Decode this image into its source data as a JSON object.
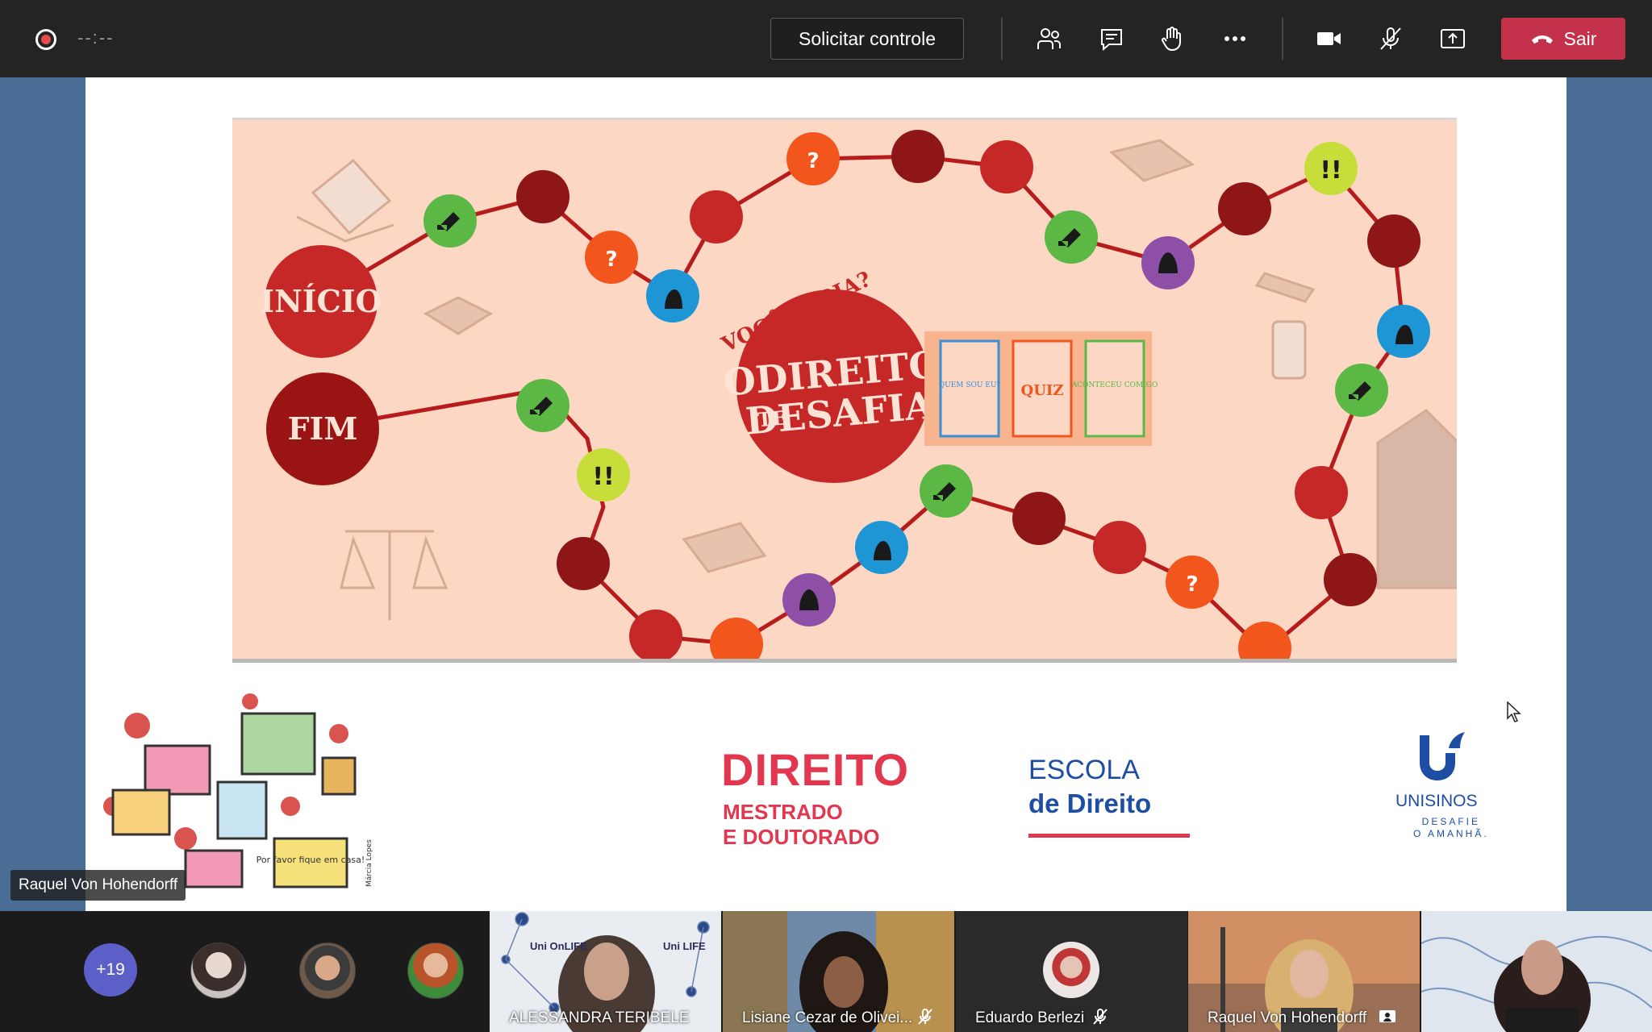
{
  "toolbar": {
    "timer": "--:--",
    "request_control_label": "Solicitar controle",
    "leave_label": "Sair",
    "icons": [
      "record-icon",
      "participants-icon",
      "chat-icon",
      "raise-hand-icon",
      "more-icon",
      "camera-icon",
      "mic-muted-icon",
      "share-icon",
      "phone-icon"
    ],
    "leave_color": "#c4314b"
  },
  "slide": {
    "board": {
      "start_label": "INÍCIO",
      "end_label": "FIM",
      "tagline": "VOCÊ SABIA?",
      "title_line1": "ODIREITO",
      "title_line2_small": "TE",
      "title_line2": "DESAFIA!",
      "cards": [
        "QUEM SOU EU?",
        "QUIZ",
        "ACONTECEU COMIGO"
      ],
      "background_color": "#fbd7c4",
      "path_color": "#b71c1c"
    },
    "illustration_signature": "Márcia Lopes",
    "illustration_note": "Por favor fique em casa!",
    "program_title": "DIREITO",
    "program_sub1": "MESTRADO",
    "program_sub2": "E DOUTORADO",
    "school_line1": "ESCOLA",
    "school_line2": "de Direito",
    "university_name": "UNISINOS",
    "university_tagline_1": "DESAFIE",
    "university_tagline_2": "O AMANHÃ.",
    "brand_red": "#e1374f",
    "brand_blue": "#1e4ea4"
  },
  "presenter_label": "Raquel Von Hohendorff",
  "participants": {
    "more_count": "+19",
    "tiles": [
      {
        "name": "ALESSANDRA TERIBELE",
        "muted": false,
        "overlay_1": "Uni OnLIFE",
        "overlay_2": "Uni LIFE"
      },
      {
        "name": "Lisiane Cezar de Olivei...",
        "muted": true
      },
      {
        "name": "Eduardo Berlezi",
        "muted": true
      },
      {
        "name": "Raquel Von Hohendorff",
        "muted": false,
        "presenter": true
      },
      {
        "name": "",
        "muted": false
      }
    ]
  }
}
